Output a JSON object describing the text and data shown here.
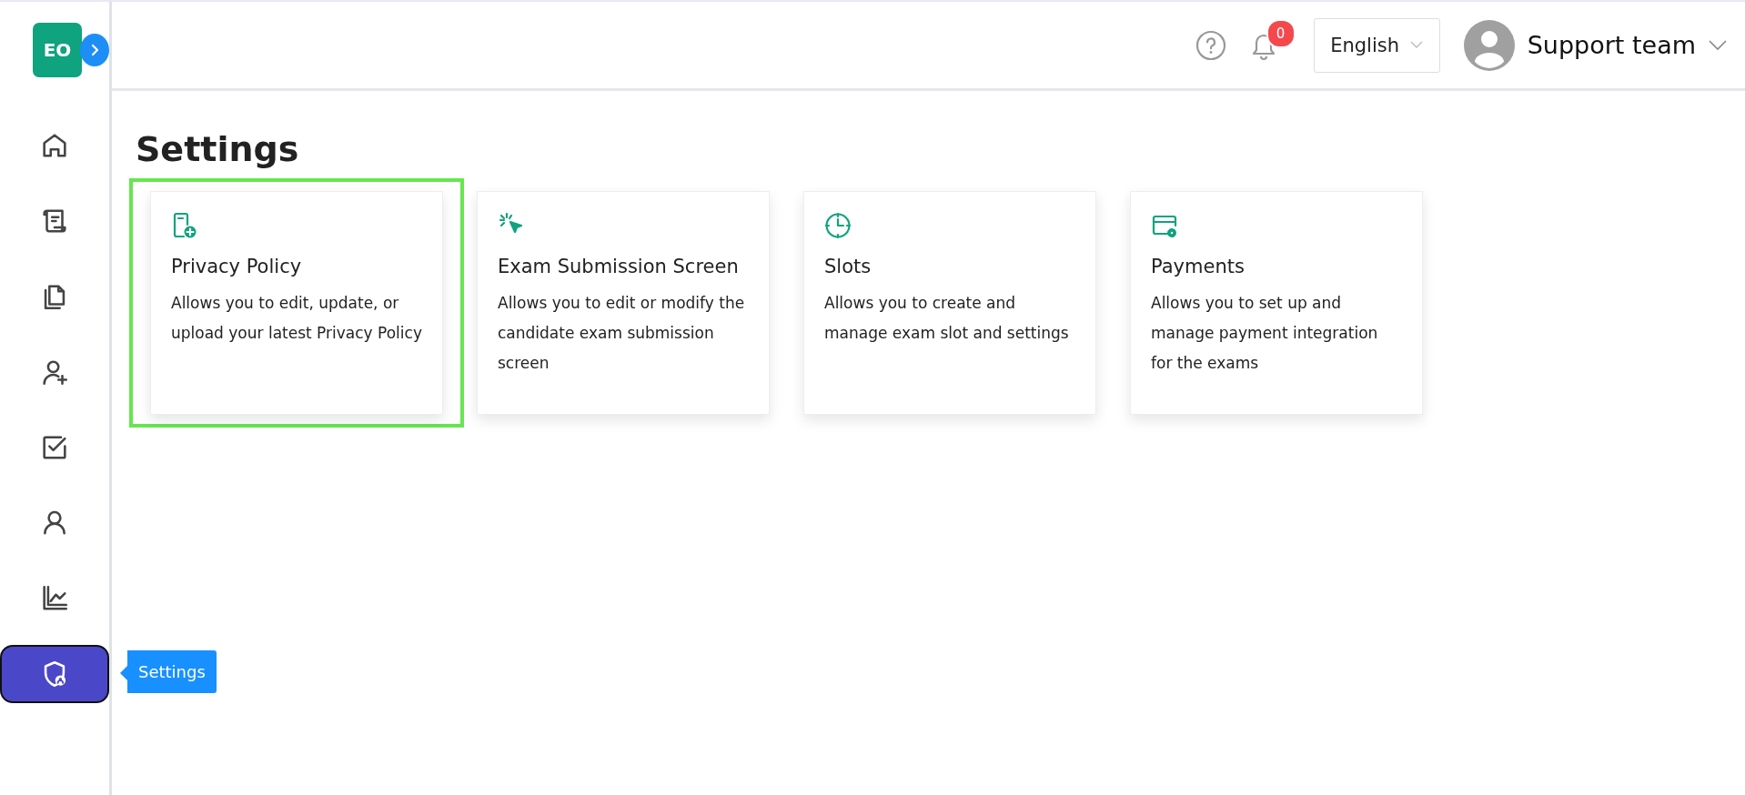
{
  "header": {
    "logo": "EO",
    "notification_count": "0",
    "language": "English",
    "user_name": "Support team"
  },
  "sidebar": {
    "items": [
      {
        "selected": false
      },
      {
        "selected": false
      },
      {
        "selected": false
      },
      {
        "selected": false
      },
      {
        "selected": false
      },
      {
        "selected": false
      },
      {
        "selected": false
      },
      {
        "selected": true
      }
    ],
    "tooltip": "Settings"
  },
  "page": {
    "title": "Settings"
  },
  "cards": [
    {
      "title": "Privacy Policy",
      "description": "Allows you to edit, update, or upload your latest Privacy Policy",
      "selected": true
    },
    {
      "title": "Exam Submission Screen",
      "description": "Allows you to edit or modify the candidate exam submission screen",
      "selected": false
    },
    {
      "title": "Slots",
      "description": "Allows you to create and manage exam slot and settings",
      "selected": false
    },
    {
      "title": "Payments",
      "description": "Allows you to set up and manage payment integration for the exams",
      "selected": false
    }
  ]
}
